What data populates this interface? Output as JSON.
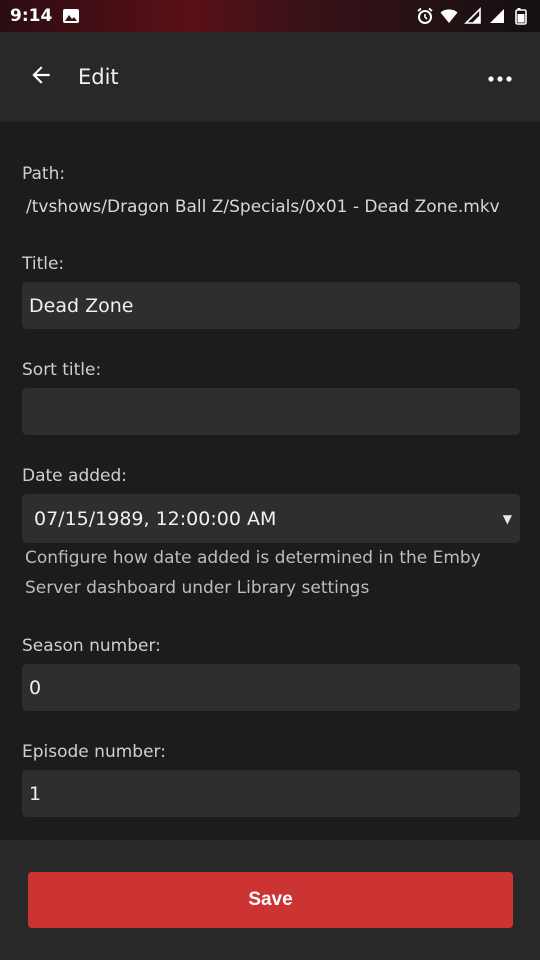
{
  "status_bar": {
    "time": "9:14",
    "icons": [
      "image-icon",
      "alarm-icon",
      "wifi-icon",
      "signal-icon",
      "signal-icon",
      "battery-icon"
    ]
  },
  "header": {
    "title": "Edit",
    "back_icon": "back-arrow-icon",
    "more_icon": "more-horizontal-icon"
  },
  "form": {
    "path": {
      "label": "Path:",
      "value": "/tvshows/Dragon Ball Z/Specials/0x01 - Dead Zone.mkv"
    },
    "title": {
      "label": "Title:",
      "value": "Dead Zone"
    },
    "sort_title": {
      "label": "Sort title:",
      "value": ""
    },
    "date_added": {
      "label": "Date added:",
      "value": "07/15/1989, 12:00:00 AM",
      "help_line1": "Configure how date added is determined in the Emby",
      "help_line2": "Server dashboard under Library settings"
    },
    "season_number": {
      "label": "Season number:",
      "value": "0"
    },
    "episode_number": {
      "label": "Episode number:",
      "value": "1"
    }
  },
  "footer": {
    "save_label": "Save"
  },
  "colors": {
    "background": "#1c1c1c",
    "app_bar": "#282828",
    "input": "#2e2e2e",
    "accent": "#cc3333"
  }
}
